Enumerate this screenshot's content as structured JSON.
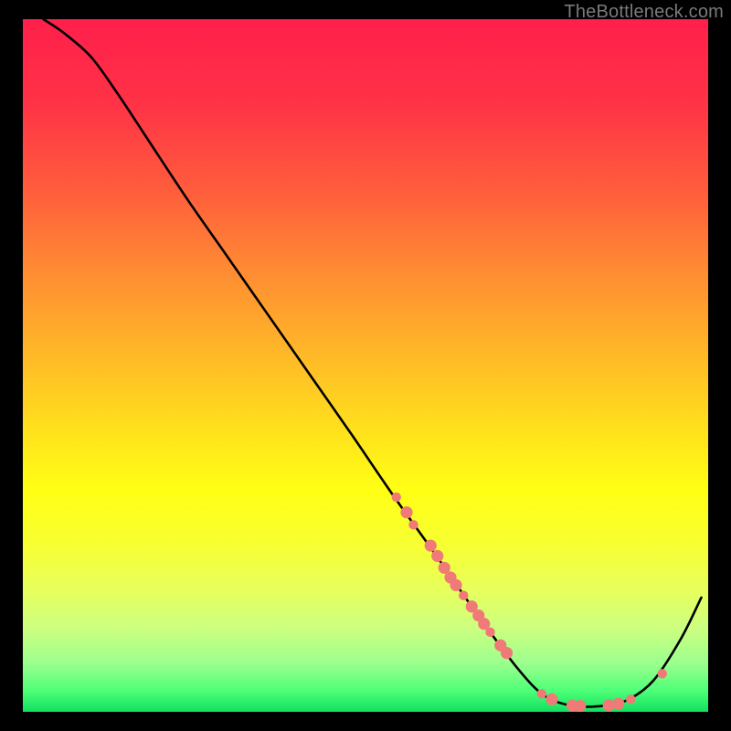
{
  "attribution": "TheBottleneck.com",
  "chart_data": {
    "type": "line",
    "title": "",
    "xlabel": "",
    "ylabel": "",
    "xlim": [
      0,
      100
    ],
    "ylim": [
      0,
      100
    ],
    "grid": false,
    "legend": false,
    "background_gradient_stops": [
      {
        "offset": 0.0,
        "color": "#ff1f4b"
      },
      {
        "offset": 0.12,
        "color": "#ff3246"
      },
      {
        "offset": 0.24,
        "color": "#ff5a3d"
      },
      {
        "offset": 0.36,
        "color": "#ff8a33"
      },
      {
        "offset": 0.48,
        "color": "#ffb728"
      },
      {
        "offset": 0.6,
        "color": "#ffe31c"
      },
      {
        "offset": 0.68,
        "color": "#ffff14"
      },
      {
        "offset": 0.76,
        "color": "#f7ff33"
      },
      {
        "offset": 0.82,
        "color": "#e8ff5a"
      },
      {
        "offset": 0.88,
        "color": "#ccff80"
      },
      {
        "offset": 0.93,
        "color": "#9bff8e"
      },
      {
        "offset": 0.97,
        "color": "#4dff77"
      },
      {
        "offset": 1.0,
        "color": "#10e060"
      }
    ],
    "series": [
      {
        "name": "bottleneck-curve",
        "color": "#000000",
        "x": [
          3,
          6,
          10,
          14,
          18,
          24,
          30,
          36,
          42,
          48,
          54,
          60,
          66,
          72,
          76,
          80,
          84,
          88,
          92,
          96,
          99
        ],
        "y": [
          100,
          98,
          94.5,
          89,
          83,
          74,
          65.5,
          57,
          48.5,
          40,
          31.3,
          23,
          14.5,
          6.5,
          2.4,
          0.9,
          0.8,
          1.6,
          4.5,
          10.5,
          16.5
        ]
      }
    ],
    "scatter": {
      "name": "highlight-dots",
      "color": "#f07a78",
      "radius_small": 5.2,
      "radius_large": 6.6,
      "points": [
        {
          "x": 54.5,
          "y": 31.0,
          "r": "s"
        },
        {
          "x": 56.0,
          "y": 28.8,
          "r": "l"
        },
        {
          "x": 57.0,
          "y": 27.0,
          "r": "s"
        },
        {
          "x": 59.5,
          "y": 24.0,
          "r": "l"
        },
        {
          "x": 60.5,
          "y": 22.5,
          "r": "l"
        },
        {
          "x": 61.5,
          "y": 20.8,
          "r": "l"
        },
        {
          "x": 62.4,
          "y": 19.4,
          "r": "l"
        },
        {
          "x": 63.2,
          "y": 18.3,
          "r": "l"
        },
        {
          "x": 64.3,
          "y": 16.8,
          "r": "s"
        },
        {
          "x": 65.5,
          "y": 15.2,
          "r": "l"
        },
        {
          "x": 66.5,
          "y": 13.9,
          "r": "l"
        },
        {
          "x": 67.3,
          "y": 12.7,
          "r": "l"
        },
        {
          "x": 68.2,
          "y": 11.5,
          "r": "s"
        },
        {
          "x": 69.7,
          "y": 9.6,
          "r": "l"
        },
        {
          "x": 70.6,
          "y": 8.5,
          "r": "l"
        },
        {
          "x": 75.7,
          "y": 2.6,
          "r": "s"
        },
        {
          "x": 77.2,
          "y": 1.8,
          "r": "l"
        },
        {
          "x": 80.2,
          "y": 0.9,
          "r": "l"
        },
        {
          "x": 81.3,
          "y": 0.85,
          "r": "l"
        },
        {
          "x": 85.5,
          "y": 0.95,
          "r": "l"
        },
        {
          "x": 86.9,
          "y": 1.15,
          "r": "l"
        },
        {
          "x": 88.7,
          "y": 1.8,
          "r": "s"
        },
        {
          "x": 93.3,
          "y": 5.5,
          "r": "s"
        }
      ]
    }
  }
}
